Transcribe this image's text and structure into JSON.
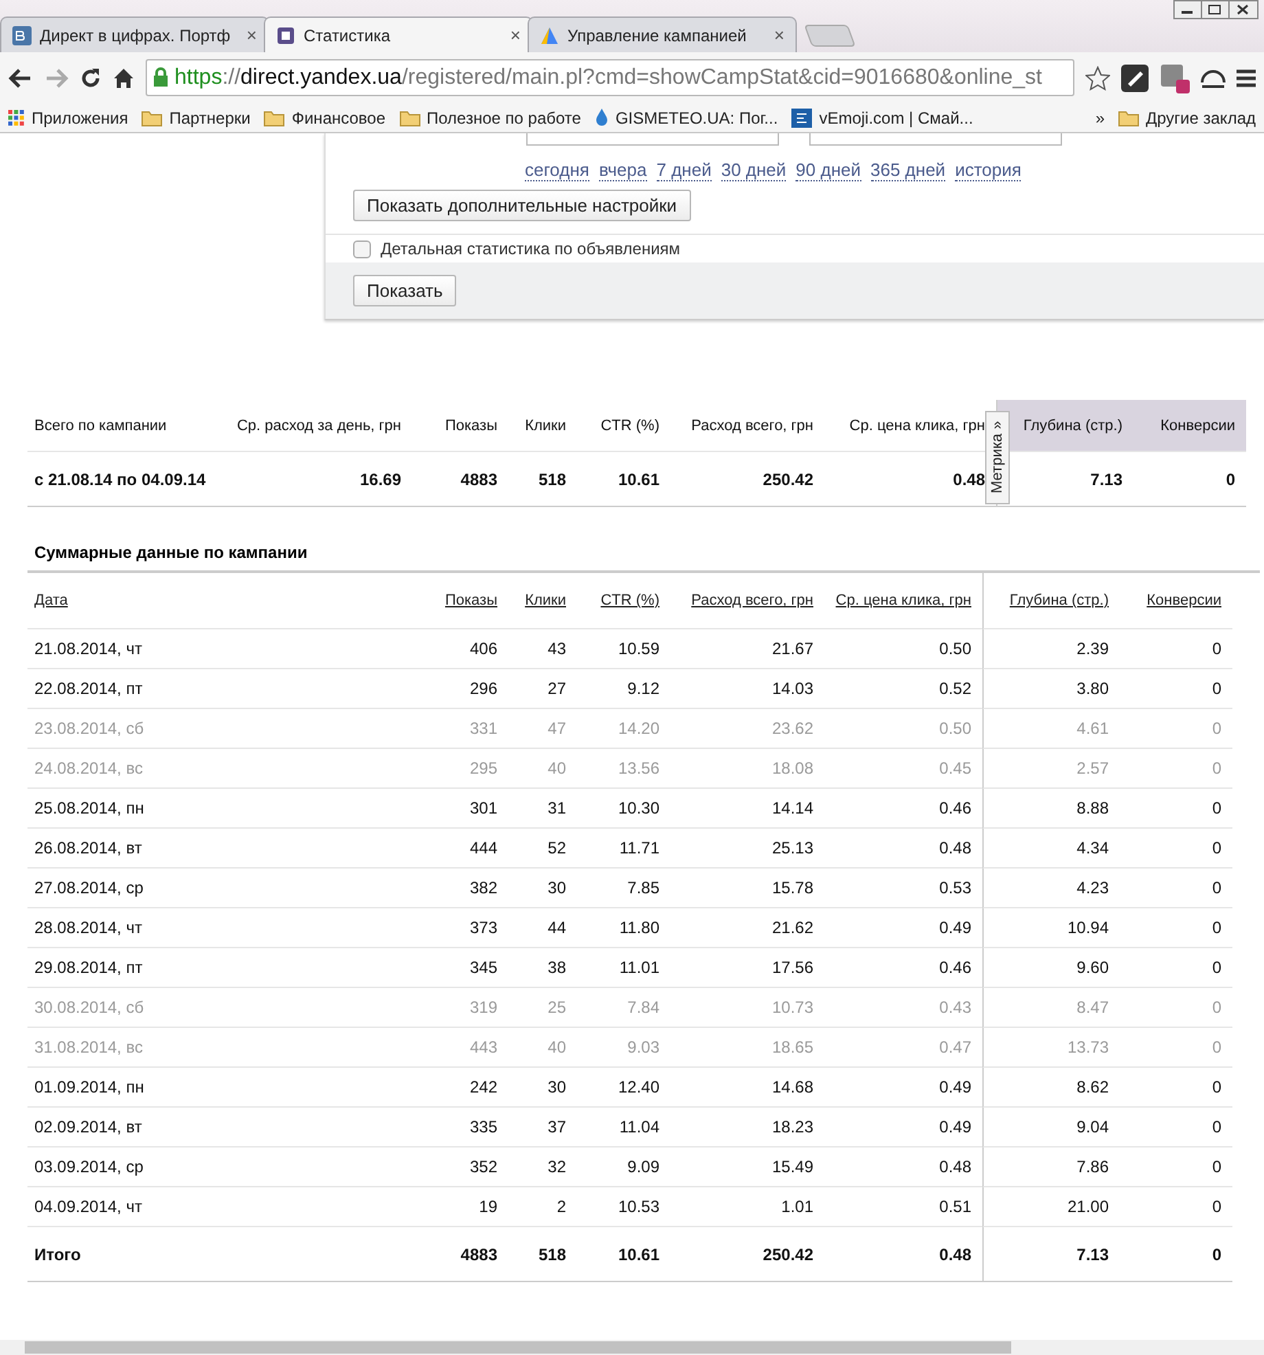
{
  "browser": {
    "tabs": [
      {
        "title": "Директ в цифрах. Портф",
        "close": "×",
        "kind": "vk",
        "selected": false
      },
      {
        "title": "Статистика",
        "close": "×",
        "kind": "yandex",
        "selected": true
      },
      {
        "title": "Управление кампанией",
        "close": "×",
        "kind": "adwords",
        "selected": false
      }
    ],
    "url": {
      "scheme": "https",
      "sep": "://",
      "host": "direct.yandex.ua",
      "path": "/registered/main.pl?cmd=showCampStat&cid=9016680&online_st"
    },
    "bookmarks": [
      {
        "kind": "apps",
        "label": "Приложения"
      },
      {
        "kind": "folder",
        "label": "Партнерки"
      },
      {
        "kind": "folder",
        "label": "Финансовое"
      },
      {
        "kind": "folder",
        "label": "Полезное по работе"
      },
      {
        "kind": "drop",
        "label": "GISMETEO.UA: Пог..."
      },
      {
        "kind": "site",
        "label": "vEmoji.com | Смай..."
      }
    ],
    "more": "»",
    "other": {
      "kind": "folder",
      "label": "Другие заклад"
    }
  },
  "form": {
    "periods": [
      "сегодня",
      "вчера",
      "7 дней",
      "30 дней",
      "90 дней",
      "365 дней",
      "история"
    ],
    "extra_button": "Показать дополнительные настройки",
    "detail_checkbox": {
      "label": "Детальная статистика по объявлениям",
      "checked": false
    },
    "show_button": "Показать"
  },
  "summary": {
    "columns": [
      "Всего по кампании",
      "Ср. расход за день, грн",
      "Показы",
      "Клики",
      "CTR (%)",
      "Расход всего, грн",
      "Ср. цена клика, грн",
      "Глубина (стр.)",
      "Конверсии"
    ],
    "metrika_tab": "Метрика »",
    "row": [
      "с 21.08.14 по 04.09.14",
      "16.69",
      "4883",
      "518",
      "10.61",
      "250.42",
      "0.48",
      "7.13",
      "0"
    ]
  },
  "table": {
    "title": "Суммарные данные по кампании",
    "columns": [
      "Дата",
      "Показы",
      "Клики",
      "CTR (%)",
      "Расход всего, грн",
      "Ср. цена клика, грн",
      "Глубина (стр.)",
      "Конверсии"
    ],
    "rows": [
      {
        "weekend": false,
        "cells": [
          "21.08.2014, чт",
          "406",
          "43",
          "10.59",
          "21.67",
          "0.50",
          "2.39",
          "0"
        ]
      },
      {
        "weekend": false,
        "cells": [
          "22.08.2014, пт",
          "296",
          "27",
          "9.12",
          "14.03",
          "0.52",
          "3.80",
          "0"
        ]
      },
      {
        "weekend": true,
        "cells": [
          "23.08.2014, сб",
          "331",
          "47",
          "14.20",
          "23.62",
          "0.50",
          "4.61",
          "0"
        ]
      },
      {
        "weekend": true,
        "cells": [
          "24.08.2014, вс",
          "295",
          "40",
          "13.56",
          "18.08",
          "0.45",
          "2.57",
          "0"
        ]
      },
      {
        "weekend": false,
        "cells": [
          "25.08.2014, пн",
          "301",
          "31",
          "10.30",
          "14.14",
          "0.46",
          "8.88",
          "0"
        ]
      },
      {
        "weekend": false,
        "cells": [
          "26.08.2014, вт",
          "444",
          "52",
          "11.71",
          "25.13",
          "0.48",
          "4.34",
          "0"
        ]
      },
      {
        "weekend": false,
        "cells": [
          "27.08.2014, ср",
          "382",
          "30",
          "7.85",
          "15.78",
          "0.53",
          "4.23",
          "0"
        ]
      },
      {
        "weekend": false,
        "cells": [
          "28.08.2014, чт",
          "373",
          "44",
          "11.80",
          "21.62",
          "0.49",
          "10.94",
          "0"
        ]
      },
      {
        "weekend": false,
        "cells": [
          "29.08.2014, пт",
          "345",
          "38",
          "11.01",
          "17.56",
          "0.46",
          "9.60",
          "0"
        ]
      },
      {
        "weekend": true,
        "cells": [
          "30.08.2014, сб",
          "319",
          "25",
          "7.84",
          "10.73",
          "0.43",
          "8.47",
          "0"
        ]
      },
      {
        "weekend": true,
        "cells": [
          "31.08.2014, вс",
          "443",
          "40",
          "9.03",
          "18.65",
          "0.47",
          "13.73",
          "0"
        ]
      },
      {
        "weekend": false,
        "cells": [
          "01.09.2014, пн",
          "242",
          "30",
          "12.40",
          "14.68",
          "0.49",
          "8.62",
          "0"
        ]
      },
      {
        "weekend": false,
        "cells": [
          "02.09.2014, вт",
          "335",
          "37",
          "11.04",
          "18.23",
          "0.49",
          "9.04",
          "0"
        ]
      },
      {
        "weekend": false,
        "cells": [
          "03.09.2014, ср",
          "352",
          "32",
          "9.09",
          "15.49",
          "0.48",
          "7.86",
          "0"
        ]
      },
      {
        "weekend": false,
        "cells": [
          "04.09.2014, чт",
          "19",
          "2",
          "10.53",
          "1.01",
          "0.51",
          "21.00",
          "0"
        ]
      }
    ],
    "total": [
      "Итого",
      "4883",
      "518",
      "10.61",
      "250.42",
      "0.48",
      "7.13",
      "0"
    ]
  }
}
